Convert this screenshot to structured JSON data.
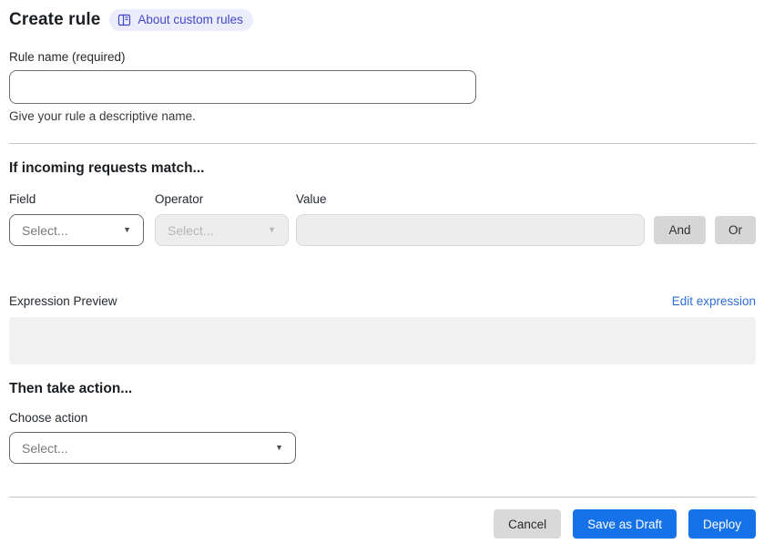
{
  "header": {
    "title": "Create rule",
    "about_badge_label": "About custom rules"
  },
  "rule_name": {
    "label": "Rule name (required)",
    "value": "",
    "helper": "Give your rule a descriptive name."
  },
  "match_section": {
    "heading": "If incoming requests match...",
    "field": {
      "label": "Field",
      "selected": "Select..."
    },
    "operator": {
      "label": "Operator",
      "selected": "Select..."
    },
    "value": {
      "label": "Value",
      "value": ""
    },
    "and_button_label": "And",
    "or_button_label": "Or",
    "expression_preview_label": "Expression Preview",
    "edit_expression_label": "Edit expression",
    "expression_value": ""
  },
  "action_section": {
    "heading": "Then take action...",
    "choose_action_label": "Choose action",
    "action_select": {
      "selected": "Select..."
    }
  },
  "footer": {
    "cancel_label": "Cancel",
    "save_draft_label": "Save as Draft",
    "deploy_label": "Deploy"
  },
  "colors": {
    "primary_blue": "#1672e8",
    "link_blue": "#2f6fd6",
    "badge_bg": "#ecedfa",
    "badge_text": "#4247ca",
    "disabled_bg": "#ededed",
    "chip_gray": "#d6d6d6"
  }
}
